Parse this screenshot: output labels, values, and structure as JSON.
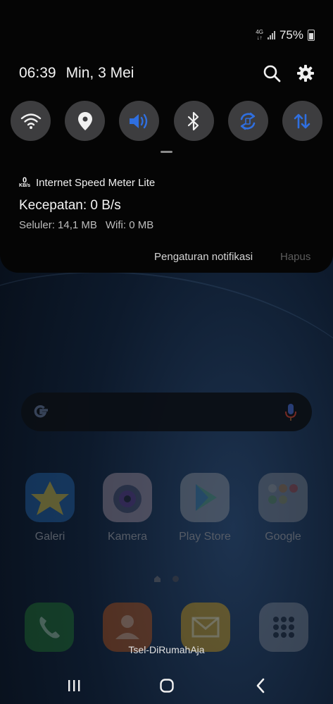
{
  "status_bar": {
    "network": "4G",
    "battery": "75%"
  },
  "header": {
    "time": "06:39",
    "date": "Min, 3 Mei"
  },
  "quick_settings": [
    {
      "name": "wifi",
      "active": false
    },
    {
      "name": "location",
      "active": false
    },
    {
      "name": "sound",
      "active": true
    },
    {
      "name": "bluetooth",
      "active": false
    },
    {
      "name": "auto-rotate",
      "active": true
    },
    {
      "name": "mobile-data",
      "active": true
    }
  ],
  "notification": {
    "app_icon_top": "0",
    "app_icon_bottom": "KB/s",
    "app_name": "Internet Speed Meter Lite",
    "title": "Kecepatan: 0 B/s",
    "cellular": "Seluler: 14,1 MB",
    "wifi": "Wifi: 0 MB",
    "settings_label": "Pengaturan notifikasi",
    "clear_label": "Hapus"
  },
  "apps": [
    {
      "label": "Galeri"
    },
    {
      "label": "Kamera"
    },
    {
      "label": "Play Store"
    },
    {
      "label": "Google"
    }
  ],
  "carrier": "Tsel-DiRumahAja",
  "colors": {
    "active_icon": "#2f6fe0",
    "tile_bg": "#3d3d3f",
    "shade_bg": "#050505"
  }
}
